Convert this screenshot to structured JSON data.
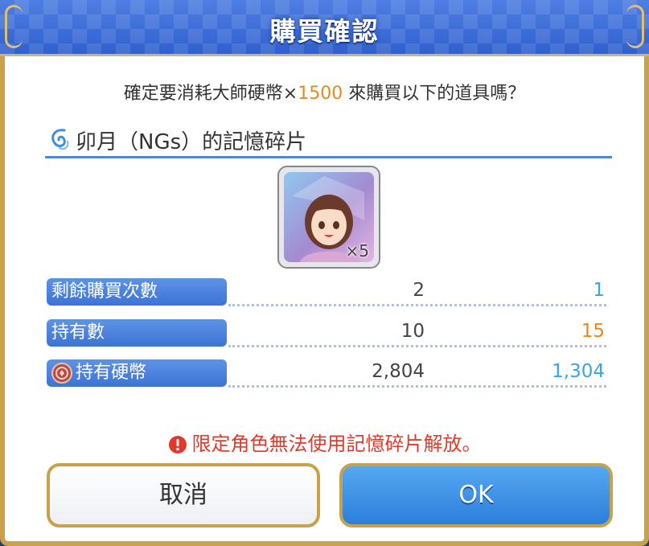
{
  "dialog": {
    "title": "購買確認",
    "prompt_before": "確定要消耗大師硬幣×",
    "prompt_amount": "1500",
    "prompt_after": " 來購買以下的道具嗎？",
    "item_name": "卯月（NGs）的記憶碎片",
    "item_count": "×5",
    "rows": [
      {
        "label": "剩餘購買次數",
        "before": "2",
        "after": "1",
        "after_color": "#3ca3e0"
      },
      {
        "label": "持有數",
        "before": "10",
        "after": "15",
        "after_color": "#e58a1f"
      },
      {
        "label": "持有硬幣",
        "before": "2,804",
        "after": "1,304",
        "after_color": "#3ca3e0"
      }
    ],
    "warning": "限定角色無法使用記憶碎片解放。",
    "cancel_label": "取消",
    "ok_label": "OK"
  },
  "icons": {
    "coin": "coin-icon",
    "warning": "warning-icon",
    "swirl": "swirl-icon"
  },
  "colors": {
    "accent_blue": "#3d73d4",
    "gold_border": "#c8a24a",
    "warning_red": "#e23a2a",
    "amount_orange": "#e58a1f"
  }
}
